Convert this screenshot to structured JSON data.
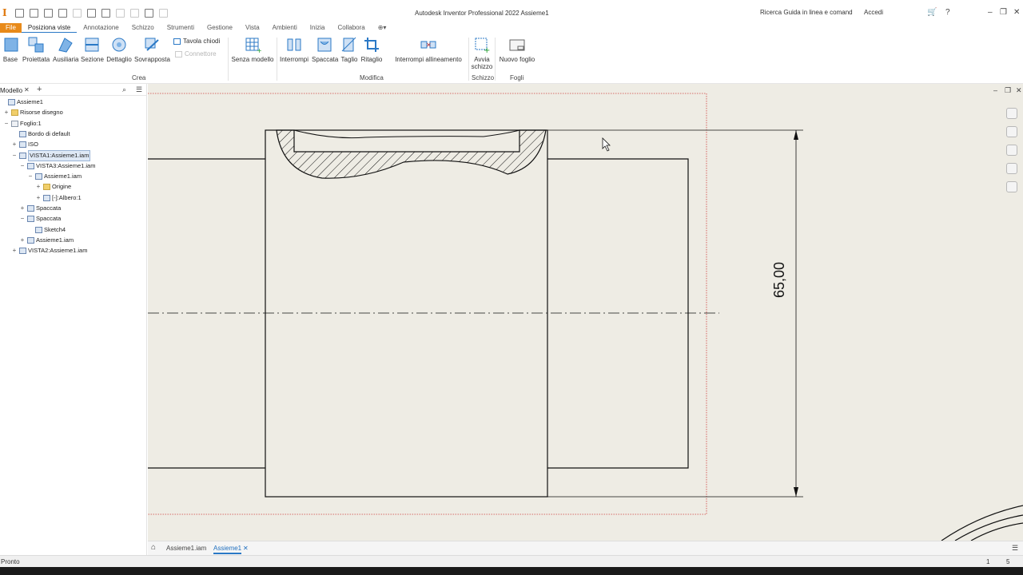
{
  "titlebar": {
    "app_title": "Autodesk Inventor Professional 2022   Assieme1",
    "help_search": "Ricerca Guida in linea e comand",
    "sign_in": "Accedi",
    "logo": "I"
  },
  "menu_tabs": [
    "File",
    "Posiziona viste",
    "Annotazione",
    "Schizzo",
    "Strumenti",
    "Gestione",
    "Vista",
    "Ambienti",
    "Inizia",
    "Collabora"
  ],
  "active_tab": "Posiziona viste",
  "ribbon": {
    "crea": {
      "group_label": "Crea",
      "buttons": [
        "Base",
        "Proiettata",
        "Ausiliaria",
        "Sezione",
        "Dettaglio",
        "Sovrapposta"
      ],
      "small": [
        "Tavola chiodi",
        "Connettore"
      ]
    },
    "modifica": {
      "group_label": "Modifica",
      "buttons": [
        "Senza modello",
        "Interrompi",
        "Spaccata",
        "Taglio",
        "Ritaglio",
        "Interrompi allineamento"
      ]
    },
    "schizzo": {
      "group_label": "Schizzo",
      "button": "Avvia schizzo"
    },
    "fogli": {
      "group_label": "Fogli",
      "button": "Nuovo foglio"
    }
  },
  "browser": {
    "title": "Modello",
    "tree": [
      {
        "label": "Assieme1",
        "icon": "drawing-icon",
        "expander": ""
      },
      {
        "label": "Risorse disegno",
        "icon": "folder-icon",
        "expander": "+"
      },
      {
        "label": "Foglio:1",
        "icon": "sheet-icon",
        "expander": "−"
      },
      {
        "label": "Bordo di default",
        "icon": "border-icon",
        "expander": ""
      },
      {
        "label": "ISO",
        "icon": "titleblock-icon",
        "expander": "+"
      },
      {
        "label": "VISTA1:Assieme1.iam",
        "icon": "view-icon",
        "expander": "−",
        "selected": true
      },
      {
        "label": "VISTA3:Assieme1.iam",
        "icon": "view-icon",
        "expander": "−"
      },
      {
        "label": "Assieme1.iam",
        "icon": "assembly-icon",
        "expander": "−"
      },
      {
        "label": "Origine",
        "icon": "folder-icon",
        "expander": "+"
      },
      {
        "label": "[-]:Albero:1",
        "icon": "part-icon",
        "expander": "+"
      },
      {
        "label": "Spaccata",
        "icon": "view-icon",
        "expander": "+"
      },
      {
        "label": "Spaccata",
        "icon": "view-icon",
        "expander": "−"
      },
      {
        "label": "Sketch4",
        "icon": "sketch-icon",
        "expander": ""
      },
      {
        "label": "Assieme1.iam",
        "icon": "assembly-icon",
        "expander": "+"
      },
      {
        "label": "VISTA2:Assieme1.iam",
        "icon": "view-icon",
        "expander": "+"
      }
    ]
  },
  "canvas": {
    "dimension_value": "65,00"
  },
  "doc_tabs": [
    "Assieme1.iam",
    "Assieme1"
  ],
  "active_doc_tab": "Assieme1",
  "status": {
    "text": "Pronto",
    "count_a": "1",
    "count_b": "5"
  },
  "colors": {
    "accent": "#2b79c6",
    "file_tab": "#e88a1a",
    "canvas_bg": "#eeece4",
    "sheet_border": "#d04040"
  }
}
